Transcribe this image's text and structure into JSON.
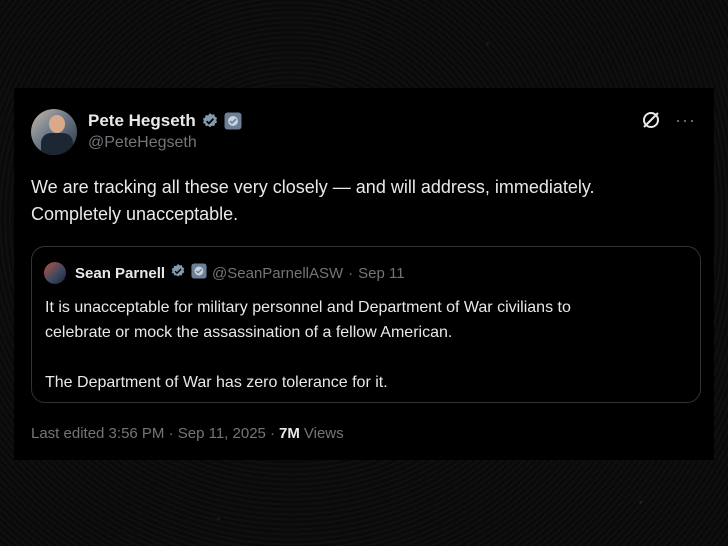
{
  "tweet": {
    "author_name": "Pete Hegseth",
    "author_handle": "@PeteHegseth",
    "text": "We are tracking all these very closely — and will address, immediately.\nCompletely unacceptable.",
    "more_label": "···"
  },
  "quote": {
    "author_name": "Sean Parnell",
    "author_handle": "@SeanParnellASW",
    "separator": "·",
    "date": "Sep 11",
    "text": "It is unacceptable for military personnel and Department of War civilians to\ncelebrate or mock the assassination of a fellow American.\n\nThe Department of War has zero tolerance for it."
  },
  "meta": {
    "edited": "Last edited 3:56 PM · Sep 11, 2025 ·",
    "views_count": "7M",
    "views_label": "Views"
  },
  "colors": {
    "background": "#000000",
    "text": "#e7e9ea",
    "secondary": "#71767b",
    "verified_badge": "#829aab",
    "border": "#2f3336"
  },
  "icons": [
    "verified-badge-icon",
    "gov-affiliation-icon",
    "grok-icon",
    "more-options-icon"
  ]
}
